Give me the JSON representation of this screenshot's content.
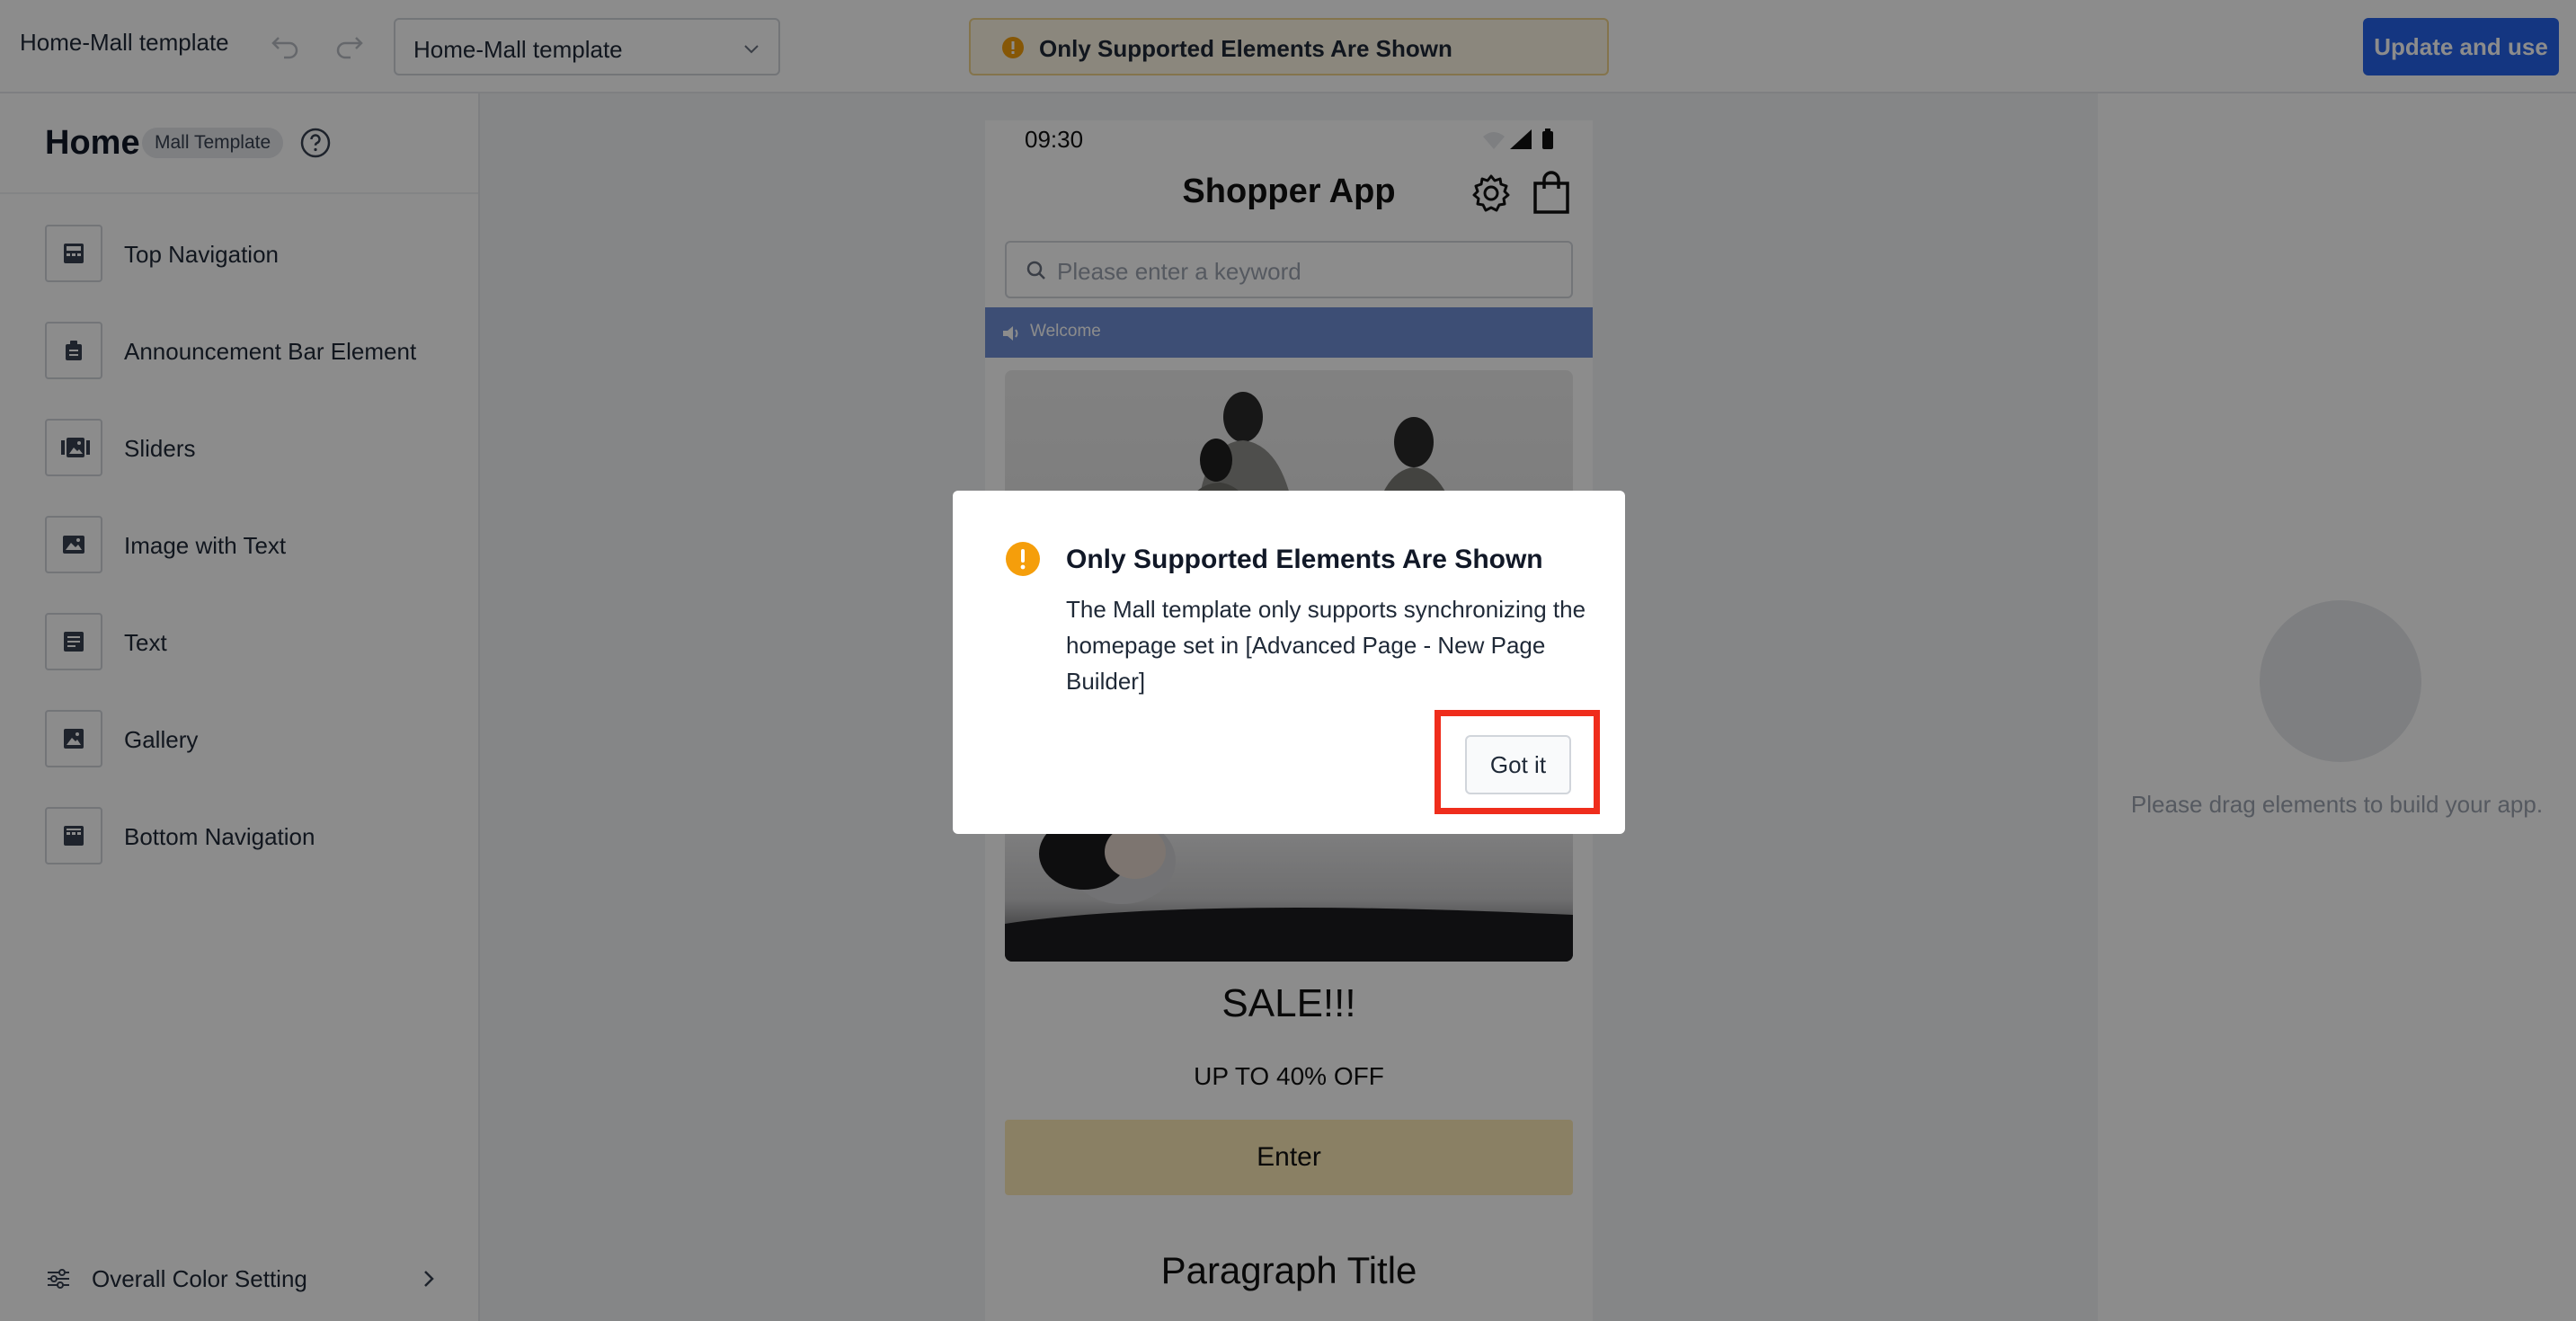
{
  "app": {
    "title": "Home-Mall template"
  },
  "toolbar": {
    "template_select_value": "Home-Mall template",
    "banner_text": "Only Supported Elements Are Shown",
    "update_button": "Update and use"
  },
  "left_panel": {
    "title": "Home",
    "badge": "Mall Template",
    "elements": [
      {
        "label": "Top Navigation",
        "icon": "top-navigation-icon"
      },
      {
        "label": "Announcement Bar Element",
        "icon": "announcement-icon"
      },
      {
        "label": "Sliders",
        "icon": "sliders-icon"
      },
      {
        "label": "Image with Text",
        "icon": "image-with-text-icon"
      },
      {
        "label": "Text",
        "icon": "text-icon"
      },
      {
        "label": "Gallery",
        "icon": "gallery-icon"
      },
      {
        "label": "Bottom Navigation",
        "icon": "bottom-navigation-icon"
      }
    ],
    "color_setting": "Overall Color Setting"
  },
  "phone": {
    "time": "09:30",
    "title": "Shopper App",
    "search_placeholder": "Please enter a keyword",
    "announcement": "Welcome",
    "sale_title": "SALE!!!",
    "sale_sub": "UP TO 40% OFF",
    "enter_button": "Enter",
    "paragraph_title": "Paragraph Title"
  },
  "right_panel": {
    "hint": "Please drag elements to build your app."
  },
  "modal": {
    "title": "Only Supported Elements Are Shown",
    "body": "The Mall template only supports synchronizing the homepage set in [Advanced Page - New Page Builder]",
    "button": "Got it"
  },
  "colors": {
    "primary": "#2563eb",
    "warning": "#f59e0b",
    "highlight": "#ef2d1c",
    "announcement_bg": "#6f8fd6"
  }
}
